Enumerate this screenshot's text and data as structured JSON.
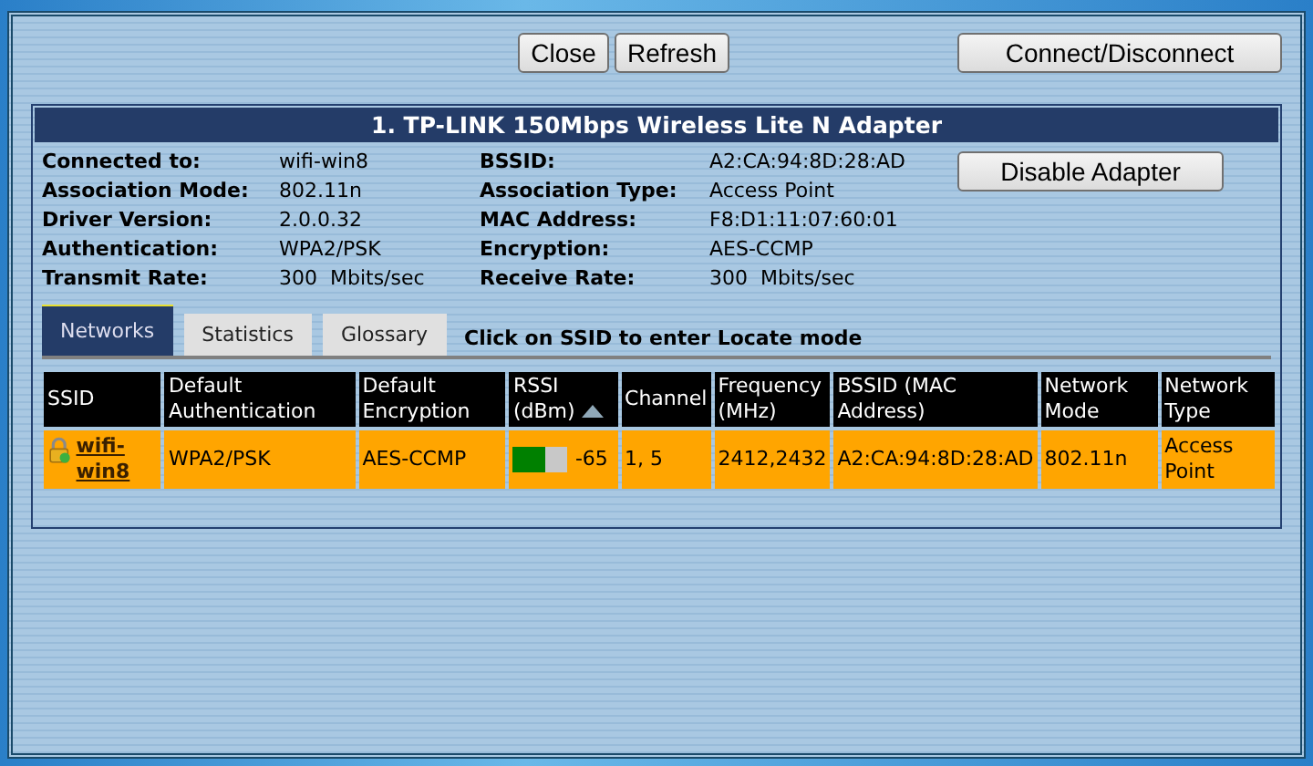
{
  "toolbar": {
    "buttons": [
      "Close",
      "Refresh"
    ],
    "connect_button": "Connect/Disconnect"
  },
  "adapter": {
    "title": "1. TP-LINK 150Mbps Wireless Lite N Adapter",
    "fields": [
      {
        "label": "Connected to:",
        "value": "wifi-win8"
      },
      {
        "label": "BSSID:",
        "value": "A2:CA:94:8D:28:AD"
      },
      {
        "label": "Association Mode:",
        "value": "802.11n"
      },
      {
        "label": "Association Type:",
        "value": "Access Point"
      },
      {
        "label": "Driver Version:",
        "value": "2.0.0.32"
      },
      {
        "label": "MAC Address:",
        "value": "F8:D1:11:07:60:01"
      },
      {
        "label": "Authentication:",
        "value": "WPA2/PSK"
      },
      {
        "label": "Encryption:",
        "value": "AES-CCMP"
      },
      {
        "label": "Transmit Rate:",
        "value": "300  Mbits/sec"
      },
      {
        "label": "Receive Rate:",
        "value": "300  Mbits/sec"
      }
    ],
    "disable_button": "Disable Adapter"
  },
  "tabs": [
    {
      "label": "Networks",
      "selected": true
    },
    {
      "label": "Statistics",
      "selected": false
    },
    {
      "label": "Glossary",
      "selected": false
    }
  ],
  "hint": "Click on SSID to enter Locate mode",
  "table": {
    "columns": [
      {
        "label": "SSID"
      },
      {
        "label": "Default Authentication"
      },
      {
        "label": "Default Encryption"
      },
      {
        "label": "RSSI (dBm)",
        "sorted": true
      },
      {
        "label": "Channel"
      },
      {
        "label": "Frequency (MHz)"
      },
      {
        "label": "BSSID (MAC Address)"
      },
      {
        "label": "Network Mode"
      },
      {
        "label": "Network Type"
      }
    ],
    "rows": [
      {
        "ssid": "wifi-win8",
        "auth": "WPA2/PSK",
        "enc": "AES-CCMP",
        "rssi": {
          "level": 0.6,
          "reading": "-65"
        },
        "channel": "1, 5",
        "frequency": "2412,2432",
        "bssid": "A2:CA:94:8D:28:AD",
        "mode": "802.11n",
        "type": "Access Point"
      }
    ]
  }
}
